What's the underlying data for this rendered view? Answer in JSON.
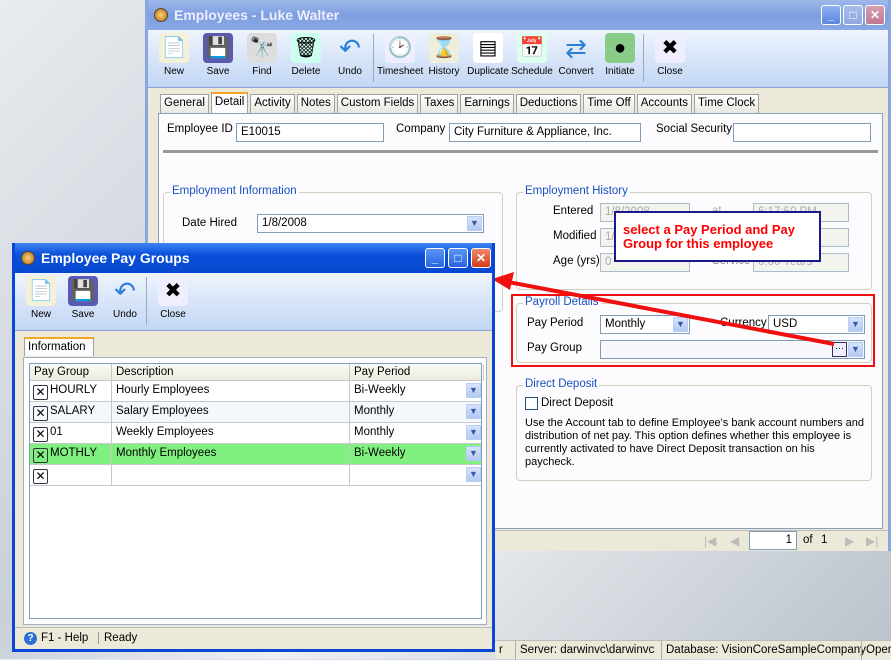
{
  "main": {
    "title": "Employees - Luke  Walter",
    "toolbar": [
      "New",
      "Save",
      "Find",
      "Delete",
      "Undo",
      "Timesheet",
      "History",
      "Duplicate",
      "Schedule",
      "Convert",
      "Initiate",
      "Close"
    ],
    "tabs": [
      "General",
      "Detail",
      "Activity",
      "Notes",
      "Custom Fields",
      "Taxes",
      "Earnings",
      "Deductions",
      "Time Off",
      "Accounts",
      "Time Clock"
    ],
    "active_tab": "Detail",
    "employee_id_label": "Employee ID",
    "employee_id": "E10015",
    "company_label": "Company",
    "company": "City Furniture & Appliance, Inc.",
    "ssn_label": "Social Security",
    "ssn": "",
    "employment_info": {
      "title": "Employment Information",
      "date_hired_label": "Date Hired",
      "date_hired": "1/8/2008"
    },
    "history": {
      "title": "Employment History",
      "entered_label": "Entered",
      "entered": "1/8/2008",
      "at_label": "at",
      "entered_time": "6:17:50 PM",
      "modified_label": "Modified",
      "modified": "1/8",
      "age_label": "Age (yrs)",
      "age": "0",
      "service_label": "Service",
      "service": "0.00 Years"
    },
    "payroll": {
      "title": "Payroll Details",
      "pay_period_label": "Pay Period",
      "pay_period": "Monthly",
      "currency_label": "Currency",
      "currency": "USD",
      "pay_group_label": "Pay Group",
      "pay_group": ""
    },
    "direct_deposit": {
      "title": "Direct Deposit",
      "checkbox_label": "Direct Deposit",
      "checked": false,
      "note": "Use the Account tab to define Employee's bank account numbers and distribution of net pay. This option defines whether this employee is currently activated to have Direct Deposit transaction on his paycheck."
    },
    "pager": {
      "page": "1",
      "of_label": "of",
      "total": "1"
    }
  },
  "callout": "select a Pay Period and Pay Group for this employee",
  "callout_color": "#ff0000",
  "dialog": {
    "title": "Employee Pay Groups",
    "toolbar": [
      "New",
      "Save",
      "Undo",
      "Close"
    ],
    "tab": "Information",
    "columns": [
      "Pay Group",
      "Description",
      "Pay Period"
    ],
    "rows": [
      {
        "group": "HOURLY",
        "description": "Hourly Employees",
        "period": "Bi-Weekly"
      },
      {
        "group": "SALARY",
        "description": "Salary Employees",
        "period": "Monthly"
      },
      {
        "group": "01",
        "description": "Weekly Employees",
        "period": "Monthly"
      },
      {
        "group": "MOTHLY",
        "description": "Monthly Employees",
        "period": "Bi-Weekly",
        "selected": true
      },
      {
        "group": "",
        "description": "",
        "period": ""
      }
    ],
    "selected_color": "#80f080",
    "help": "F1 - Help",
    "status": "Ready"
  },
  "statusbar": {
    "partial": "r",
    "server": "Server: darwinvc\\darwinvc",
    "database": "Database: VisionCoreSampleCompany",
    "extra": "Oper"
  }
}
